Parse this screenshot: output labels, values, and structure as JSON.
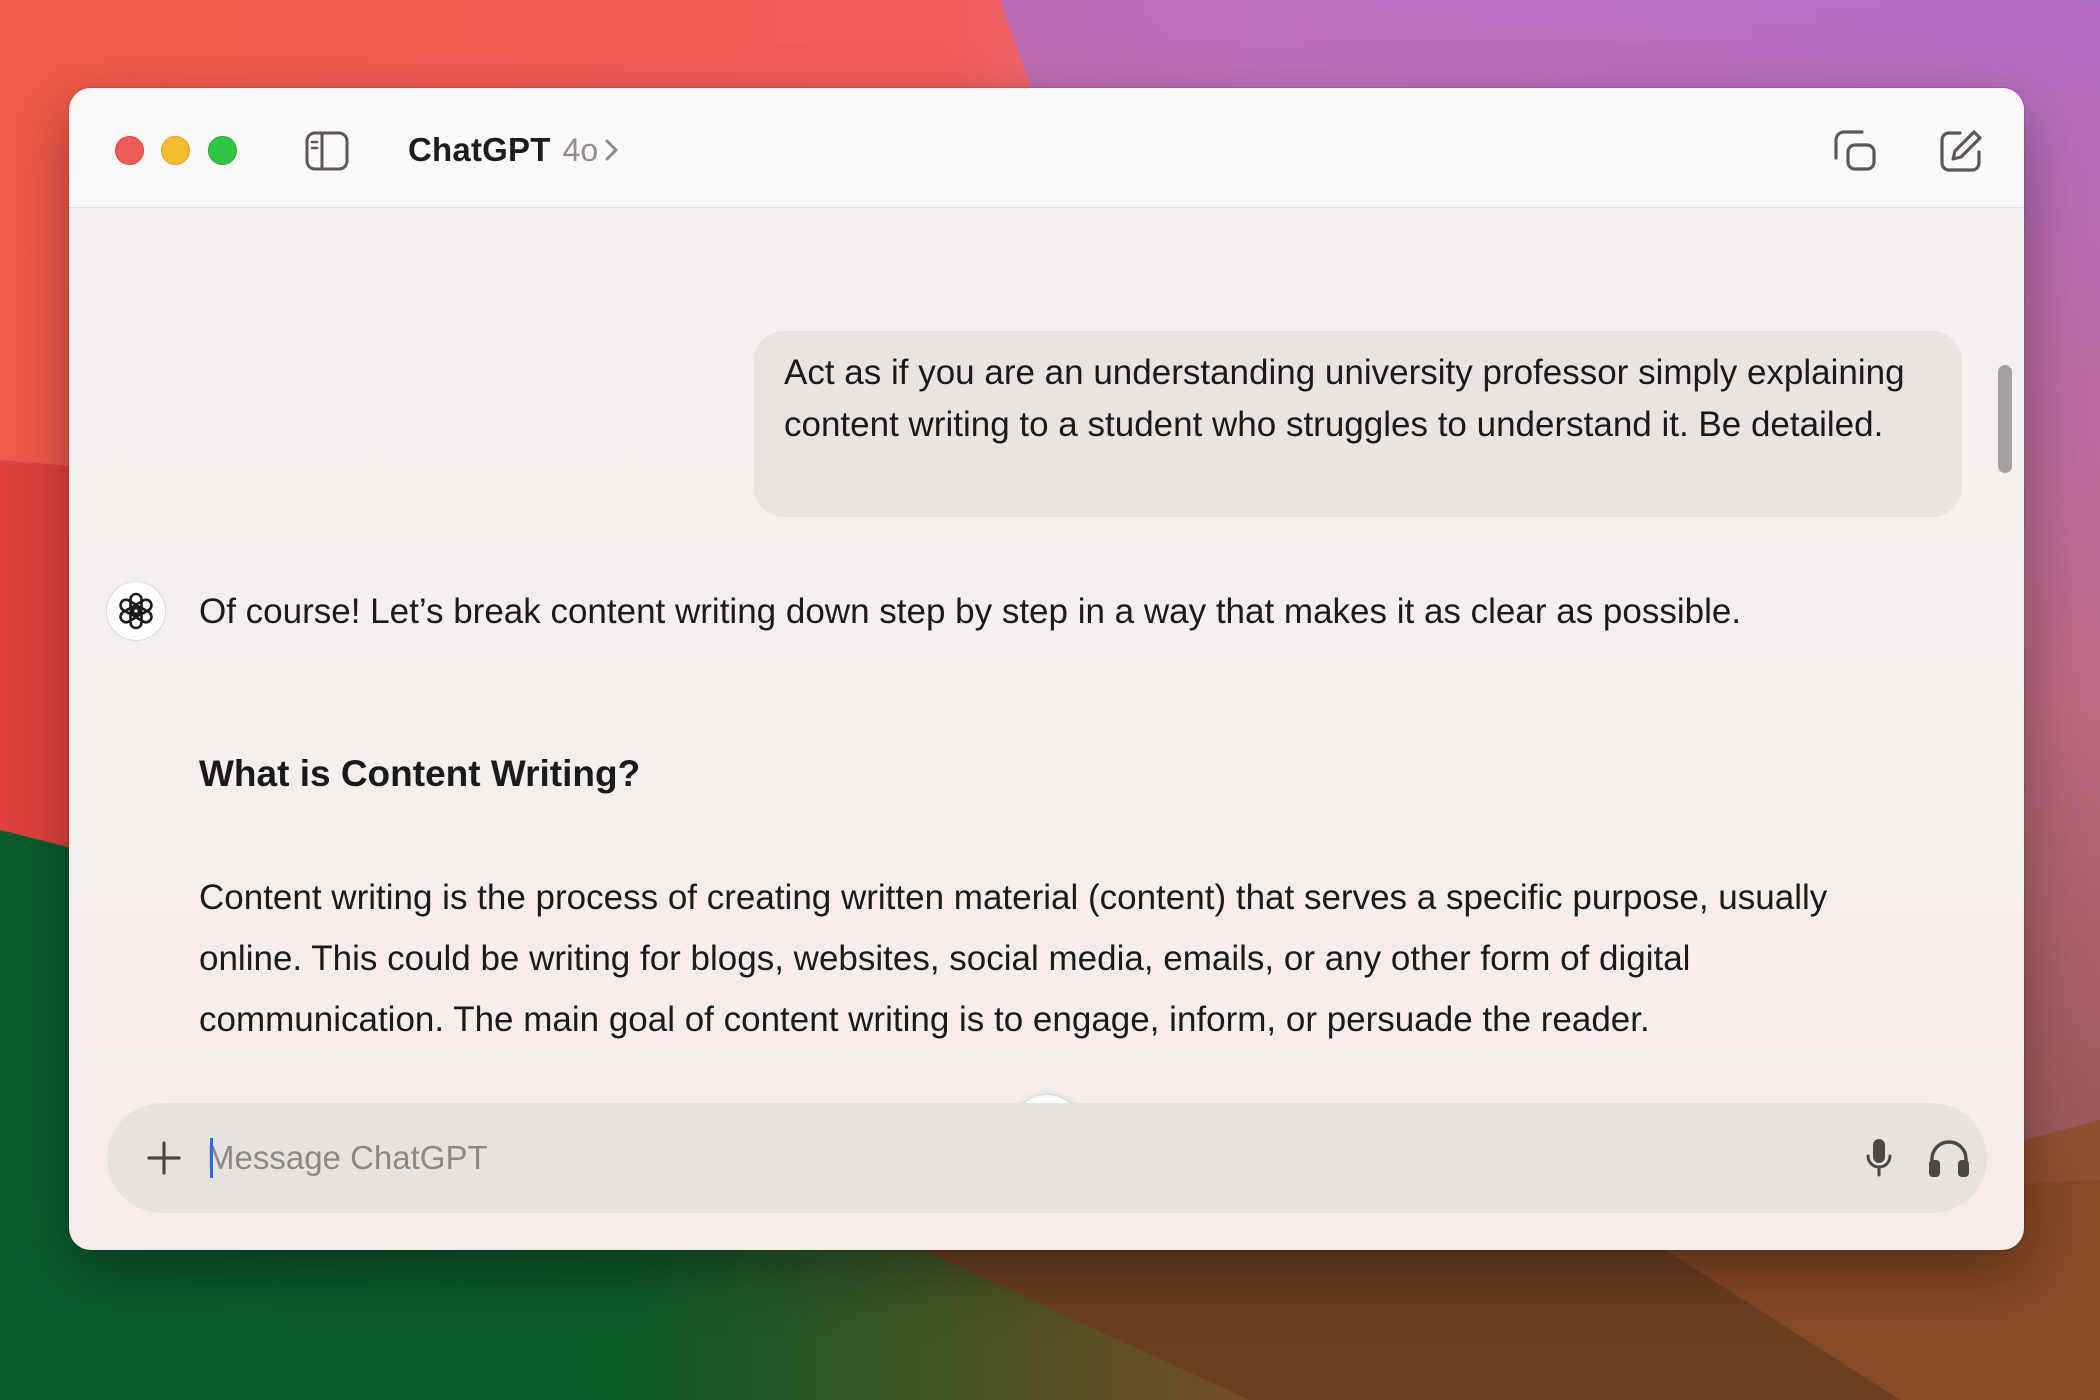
{
  "window": {
    "app_title": "ChatGPT",
    "model": "4o"
  },
  "icons": {
    "sidebar": "sidebar-toggle-icon",
    "model_chevron": "chevron-right-icon",
    "temporary_chat": "temporary-chat-icon",
    "new_chat": "compose-icon",
    "assistant_avatar": "openai-logo-icon",
    "scroll_down": "arrow-down-icon",
    "attach": "plus-icon",
    "voice_input": "microphone-icon",
    "voice_mode": "headphones-icon"
  },
  "conversation": {
    "user_message": "Act as if you are an understanding university professor simply explaining content writing to a student who struggles to understand it. Be detailed.",
    "assistant": {
      "intro": "Of course! Let’s break content writing down step by step in a way that makes it as clear as possible.",
      "heading": "What is Content Writing?",
      "paragraph": "Content writing is the process of creating written material (content) that serves a specific purpose, usually online. This could be writing for blogs, websites, social media, emails, or any other form of digital communication. The main goal of content writing is to engage, inform, or persuade the reader."
    }
  },
  "composer": {
    "placeholder": "Message ChatGPT",
    "value": ""
  },
  "colors": {
    "traffic_red": "#ee5b56",
    "traffic_yellow": "#f5bc2f",
    "traffic_green": "#2fc742",
    "window_bg": "#f4eeed",
    "user_bubble_bg": "#e9e3e2",
    "composer_bg": "#e7e1e0",
    "caret": "#2a6be6"
  }
}
